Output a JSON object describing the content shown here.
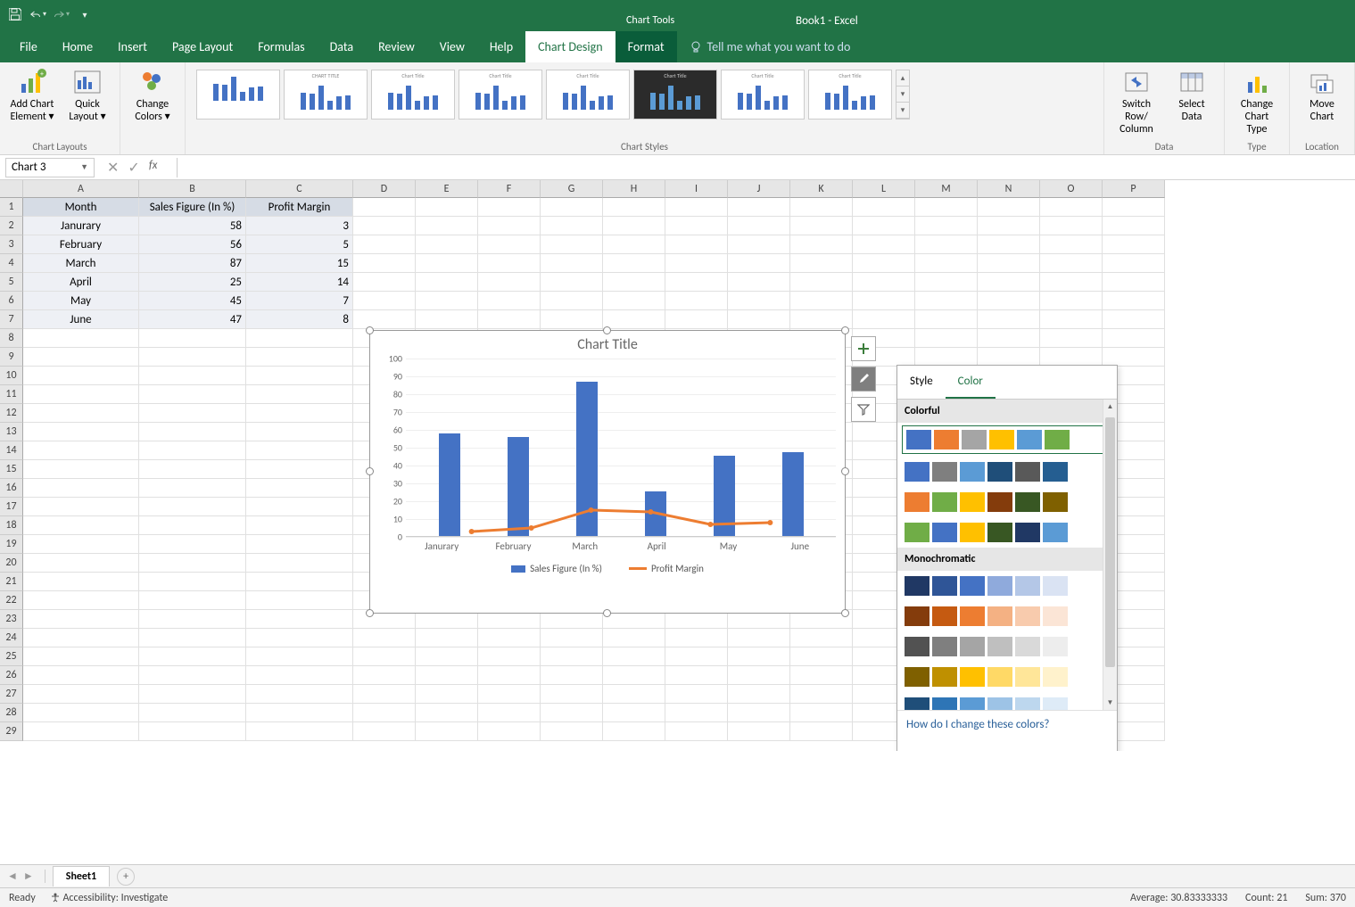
{
  "title": {
    "chart_tools": "Chart Tools",
    "document": "Book1  -  Excel"
  },
  "tabs": [
    "File",
    "Home",
    "Insert",
    "Page Layout",
    "Formulas",
    "Data",
    "Review",
    "View",
    "Help",
    "Chart Design",
    "Format"
  ],
  "active_tab": "Chart Design",
  "tell_me": "Tell me what you want to do",
  "ribbon": {
    "chart_layouts": {
      "add_element": "Add Chart Element",
      "quick_layout": "Quick Layout",
      "label": "Chart Layouts"
    },
    "change_colors": "Change Colors",
    "chart_styles_label": "Chart Styles",
    "data": {
      "switch": "Switch Row/ Column",
      "select": "Select Data",
      "label": "Data"
    },
    "type": {
      "change": "Change Chart Type",
      "label": "Type"
    },
    "location": {
      "move": "Move Chart",
      "label": "Location"
    }
  },
  "namebox": "Chart 3",
  "columns": [
    "A",
    "B",
    "C",
    "D",
    "E",
    "F",
    "G",
    "H",
    "I",
    "J",
    "K",
    "L",
    "M",
    "N",
    "O",
    "P"
  ],
  "table": {
    "headers": [
      "Month",
      "Sales Figure (In %)",
      "Profit Margin"
    ],
    "rows": [
      {
        "month": "Janurary",
        "sales": 58,
        "profit": 3
      },
      {
        "month": "February",
        "sales": 56,
        "profit": 5
      },
      {
        "month": "March",
        "sales": 87,
        "profit": 15
      },
      {
        "month": "April",
        "sales": 25,
        "profit": 14
      },
      {
        "month": "May",
        "sales": 45,
        "profit": 7
      },
      {
        "month": "June",
        "sales": 47,
        "profit": 8
      }
    ]
  },
  "chart_data": {
    "type": "bar",
    "title": "Chart Title",
    "categories": [
      "Janurary",
      "February",
      "March",
      "April",
      "May",
      "June"
    ],
    "series": [
      {
        "name": "Sales Figure (In %)",
        "type": "bar",
        "values": [
          58,
          56,
          87,
          25,
          45,
          47
        ]
      },
      {
        "name": "Profit Margin",
        "type": "line",
        "values": [
          3,
          5,
          15,
          14,
          7,
          8
        ]
      }
    ],
    "ylim": [
      0,
      100
    ],
    "yticks": [
      0,
      10,
      20,
      30,
      40,
      50,
      60,
      70,
      80,
      90,
      100
    ]
  },
  "color_panel": {
    "tabs": [
      "Style",
      "Color"
    ],
    "active_tab": "Color",
    "colorful_label": "Colorful",
    "monochromatic_label": "Monochromatic",
    "colorful": [
      [
        "#4472c4",
        "#ed7d31",
        "#a5a5a5",
        "#ffc000",
        "#5b9bd5",
        "#70ad47"
      ],
      [
        "#4472c4",
        "#7f7f7f",
        "#5b9bd5",
        "#1f4e79",
        "#595959",
        "#255e91"
      ],
      [
        "#ed7d31",
        "#70ad47",
        "#ffc000",
        "#843c0c",
        "#385723",
        "#7f6000"
      ],
      [
        "#70ad47",
        "#4472c4",
        "#ffc000",
        "#385723",
        "#203864",
        "#5b9bd5",
        "#7f6000"
      ]
    ],
    "mono": [
      [
        "#203864",
        "#2f5597",
        "#4472c4",
        "#8faadc",
        "#b4c7e7",
        "#dae3f3"
      ],
      [
        "#843c0c",
        "#c55a11",
        "#ed7d31",
        "#f4b183",
        "#f8cbad",
        "#fbe5d6"
      ],
      [
        "#525252",
        "#7f7f7f",
        "#a5a5a5",
        "#bfbfbf",
        "#d9d9d9",
        "#ededed"
      ],
      [
        "#7f6000",
        "#bf9000",
        "#ffc000",
        "#ffd966",
        "#ffe699",
        "#fff2cc"
      ],
      [
        "#1f4e79",
        "#2e75b6",
        "#5b9bd5",
        "#9dc3e6",
        "#bdd7ee",
        "#deebf7"
      ]
    ],
    "footer": "How do I change these colors?"
  },
  "sheet_tabs": [
    "Sheet1"
  ],
  "status": {
    "ready": "Ready",
    "accessibility": "Accessibility: Investigate",
    "average_label": "Average:",
    "average": "30.83333333",
    "count_label": "Count:",
    "count": "21",
    "sum_label": "Sum:",
    "sum": "370"
  }
}
